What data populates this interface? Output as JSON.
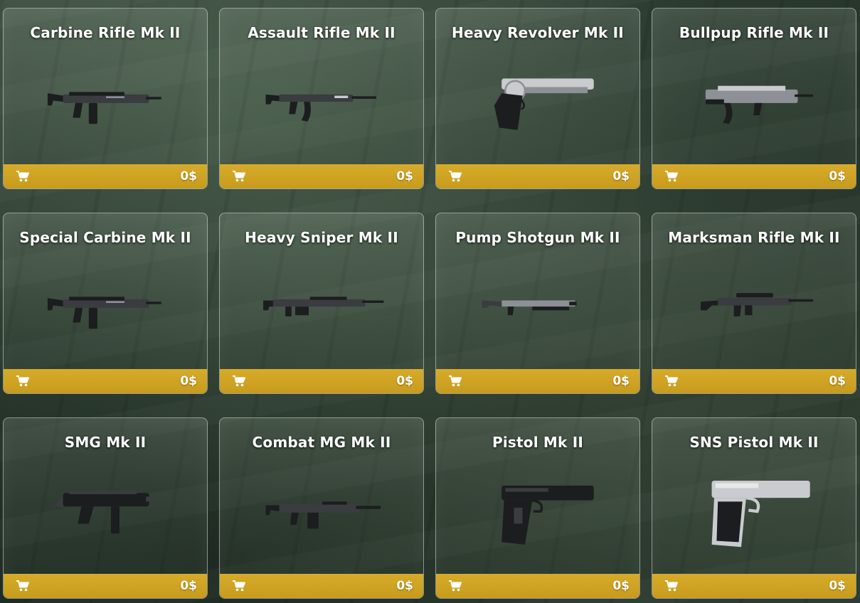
{
  "shop": {
    "accent_color": "#d1a423",
    "buy_icon": "shopping-cart-icon",
    "items": [
      {
        "name": "Carbine Rifle Mk II",
        "price": "0$",
        "icon": "carbine-rifle-icon"
      },
      {
        "name": "Assault Rifle Mk II",
        "price": "0$",
        "icon": "assault-rifle-icon"
      },
      {
        "name": "Heavy Revolver Mk II",
        "price": "0$",
        "icon": "revolver-icon"
      },
      {
        "name": "Bullpup Rifle Mk II",
        "price": "0$",
        "icon": "bullpup-rifle-icon"
      },
      {
        "name": "Special Carbine Mk II",
        "price": "0$",
        "icon": "special-carbine-icon"
      },
      {
        "name": "Heavy Sniper Mk II",
        "price": "0$",
        "icon": "sniper-rifle-icon"
      },
      {
        "name": "Pump Shotgun Mk II",
        "price": "0$",
        "icon": "shotgun-icon"
      },
      {
        "name": "Marksman Rifle Mk II",
        "price": "0$",
        "icon": "marksman-rifle-icon"
      },
      {
        "name": "SMG Mk II",
        "price": "0$",
        "icon": "smg-icon"
      },
      {
        "name": "Combat MG Mk II",
        "price": "0$",
        "icon": "machine-gun-icon"
      },
      {
        "name": "Pistol Mk II",
        "price": "0$",
        "icon": "pistol-icon"
      },
      {
        "name": "SNS Pistol Mk II",
        "price": "0$",
        "icon": "sns-pistol-icon"
      }
    ]
  }
}
